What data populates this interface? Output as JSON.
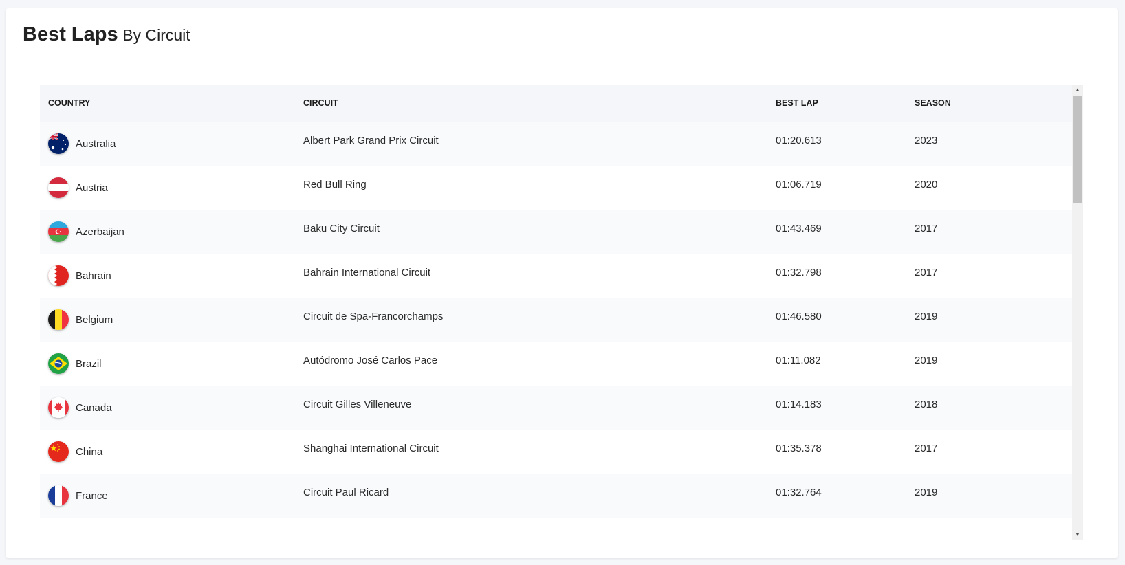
{
  "card": {
    "title_main": "Best Laps",
    "title_sub": "By Circuit"
  },
  "table": {
    "headers": {
      "country": "COUNTRY",
      "circuit": "CIRCUIT",
      "best_lap": "BEST LAP",
      "season": "SEASON"
    },
    "rows": [
      {
        "country": "Australia",
        "flag_icon": "australia-flag-icon",
        "circuit": "Albert Park Grand Prix Circuit",
        "best_lap": "01:20.613",
        "season": "2023"
      },
      {
        "country": "Austria",
        "flag_icon": "austria-flag-icon",
        "circuit": "Red Bull Ring",
        "best_lap": "01:06.719",
        "season": "2020"
      },
      {
        "country": "Azerbaijan",
        "flag_icon": "azerbaijan-flag-icon",
        "circuit": "Baku City Circuit",
        "best_lap": "01:43.469",
        "season": "2017"
      },
      {
        "country": "Bahrain",
        "flag_icon": "bahrain-flag-icon",
        "circuit": "Bahrain International Circuit",
        "best_lap": "01:32.798",
        "season": "2017"
      },
      {
        "country": "Belgium",
        "flag_icon": "belgium-flag-icon",
        "circuit": "Circuit de Spa-Francorchamps",
        "best_lap": "01:46.580",
        "season": "2019"
      },
      {
        "country": "Brazil",
        "flag_icon": "brazil-flag-icon",
        "circuit": "Autódromo José Carlos Pace",
        "best_lap": "01:11.082",
        "season": "2019"
      },
      {
        "country": "Canada",
        "flag_icon": "canada-flag-icon",
        "circuit": "Circuit Gilles Villeneuve",
        "best_lap": "01:14.183",
        "season": "2018"
      },
      {
        "country": "China",
        "flag_icon": "china-flag-icon",
        "circuit": "Shanghai International Circuit",
        "best_lap": "01:35.378",
        "season": "2017"
      },
      {
        "country": "France",
        "flag_icon": "france-flag-icon",
        "circuit": "Circuit Paul Ricard",
        "best_lap": "01:32.764",
        "season": "2019"
      }
    ]
  },
  "colors": {
    "header_bg": "#f4f6f9",
    "row_alt_bg": "#f8fafc",
    "border": "#e3e6ea"
  }
}
